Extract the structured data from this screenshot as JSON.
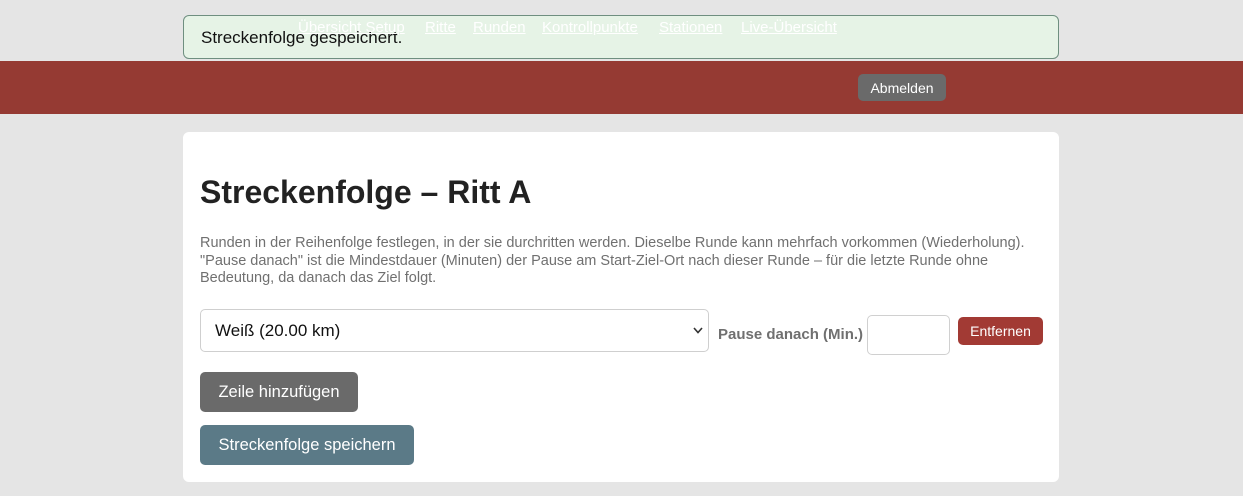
{
  "flash": {
    "message": "Streckenfolge gespeichert."
  },
  "nav": {
    "links": [
      "Übersicht Setup",
      "Ritte",
      "Runden",
      "Kontrollpunkte",
      "Stationen",
      "Live-Übersicht"
    ],
    "logout_label": "Abmelden"
  },
  "page": {
    "title": "Streckenfolge – Ritt A",
    "description": "Runden in der Reihenfolge festlegen, in der sie durchritten werden. Dieselbe Runde kann mehrfach vorkommen (Wiederholung). \"Pause danach\" ist die Mindestdauer (Minuten) der Pause am Start-Ziel-Ort nach dieser Runde – für die letzte Runde ohne Bedeutung, da danach das Ziel folgt."
  },
  "rows": [
    {
      "round_selected": "Weiß (20.00 km)",
      "pause_label": "Pause danach (Min.)",
      "pause_value": "",
      "remove_label": "Entfernen"
    }
  ],
  "actions": {
    "add_row_label": "Zeile hinzufügen",
    "save_label": "Streckenfolge speichern"
  },
  "colors": {
    "navbar": "#953a33",
    "flash_bg": "#e6f3e6",
    "remove_button": "#a23a34",
    "neutral_button": "#6a6a6a",
    "save_button": "#5b7a87"
  },
  "icons": {
    "select_toggle": "chevron-down-icon"
  }
}
